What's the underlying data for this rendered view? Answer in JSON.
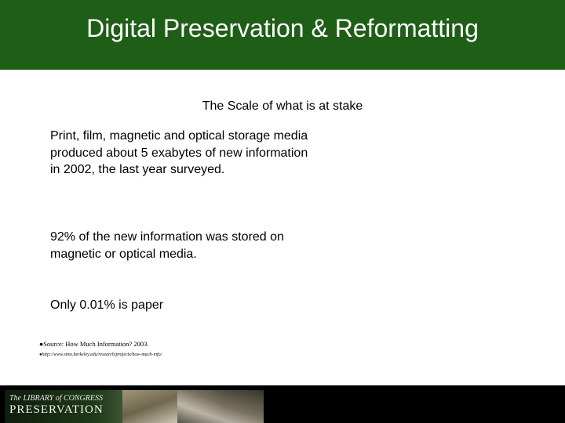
{
  "header": {
    "title": "Digital Preservation & Reformatting",
    "background": "#1f5e16"
  },
  "slide": {
    "subtitle": "The Scale of what is at stake",
    "paragraphs": [
      "Print, film, magnetic and optical storage media produced about 5 exabytes of new information in 2002, the last year surveyed.",
      "92% of the new information was stored on magnetic or optical media.",
      "Only 0.01% is paper"
    ],
    "source": "●Source: How Much Information? 2003.",
    "url": "●http://www.sims.berkeley.edu/research/projects/how-much-info/"
  },
  "footer": {
    "logo_small": "The LIBRARY of CONGRESS",
    "logo_big": "PRESERVATION"
  }
}
